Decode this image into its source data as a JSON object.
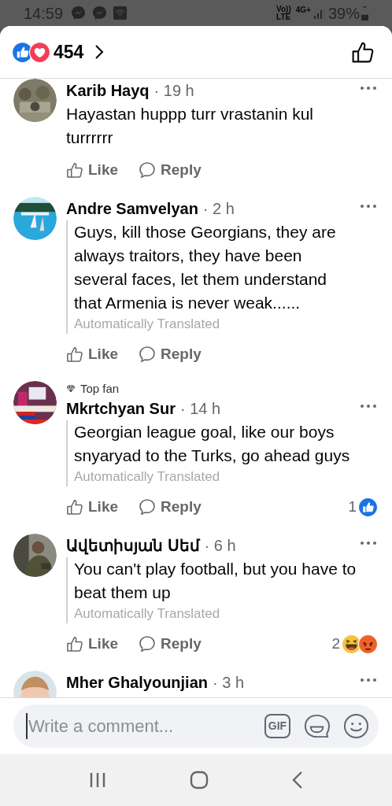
{
  "status_bar": {
    "time": "14:59",
    "network_lines": [
      "Vo))",
      "LTE"
    ],
    "data_label": "4G+",
    "battery": "39%"
  },
  "header": {
    "reactions": [
      {
        "kind": "like"
      },
      {
        "kind": "love"
      }
    ],
    "count": "454"
  },
  "comments": [
    {
      "author": "Karib Hayq",
      "time": "· 19 h",
      "text": "Hayastan huppp turr vrastanin kul turrrrrr",
      "actions": [
        "Like",
        "Reply"
      ]
    },
    {
      "author": "Andre Samvelyan",
      "time": "· 2 h",
      "text": "Guys, kill those Georgians, they are always traitors, they have been several faces, let them understand that Armenia is never weak......",
      "translated": "Automatically Translated",
      "actions": [
        "Like",
        "Reply"
      ]
    },
    {
      "badge": "Top fan",
      "author": "Mkrtchyan Sur",
      "time": "· 14 h",
      "text": "Georgian league goal, like our boys snyaryad to the Turks, go ahead guys",
      "translated": "Automatically Translated",
      "actions": [
        "Like",
        "Reply"
      ],
      "reaction_count": "1",
      "reactions": [
        {
          "kind": "like"
        }
      ]
    },
    {
      "author": "Ավետիսյան Սեմ",
      "time": "· 6 h",
      "text": "You can't play football, but you have to beat them up",
      "translated": "Automatically Translated",
      "actions": [
        "Like",
        "Reply"
      ],
      "reaction_count": "2",
      "reactions": [
        {
          "kind": "haha"
        },
        {
          "kind": "angry"
        }
      ]
    },
    {
      "author": "Mher Ghalyounjian",
      "time": "· 3 h"
    }
  ],
  "composer": {
    "placeholder": "Write a comment...",
    "gif_label": "GIF"
  }
}
